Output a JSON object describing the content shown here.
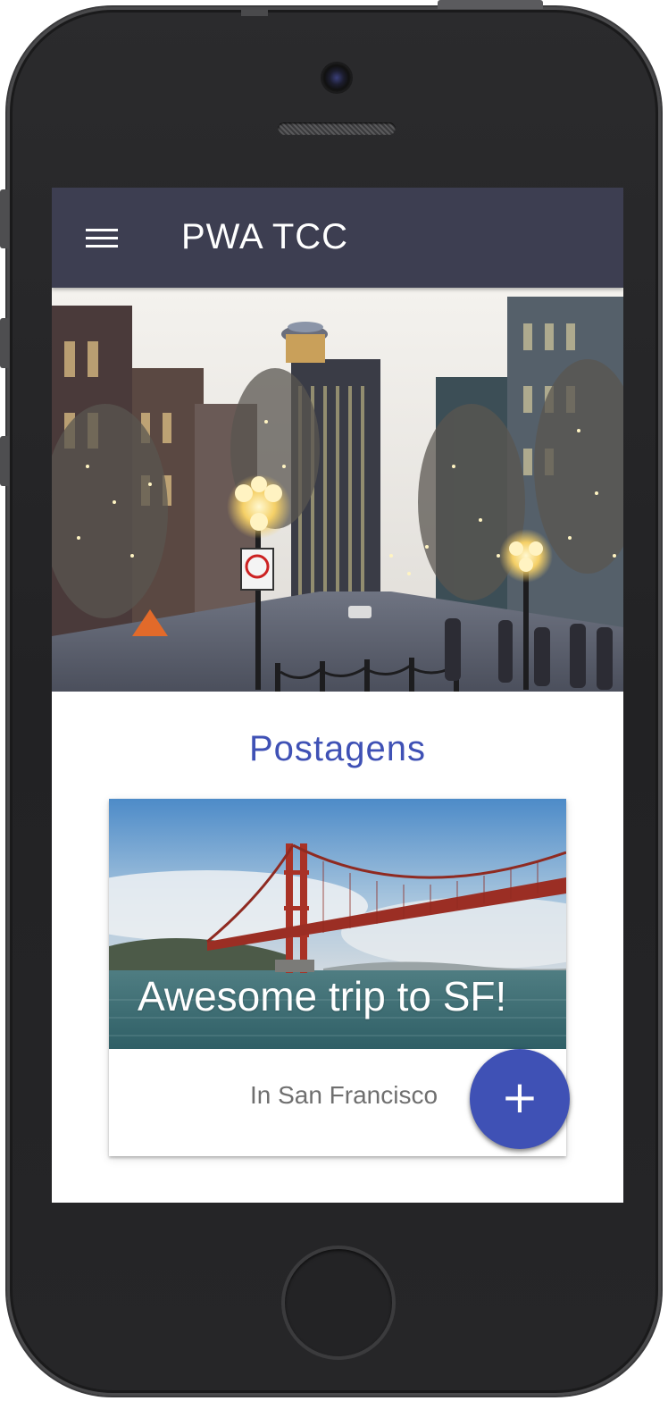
{
  "app_bar": {
    "title": "PWA TCC",
    "menu_icon": "hamburger-menu-icon",
    "background_color": "#3d3e51"
  },
  "hero": {
    "image": "city-street-evening-photo"
  },
  "main": {
    "section_title": "Postagens",
    "accent_color": "#3f51b5"
  },
  "card": {
    "image": "golden-gate-bridge-photo",
    "title": "Awesome trip to SF!",
    "supporting_text": "In San Francisco"
  },
  "fab": {
    "icon": "plus-icon",
    "glyph": "+",
    "color": "#3f51b5"
  }
}
